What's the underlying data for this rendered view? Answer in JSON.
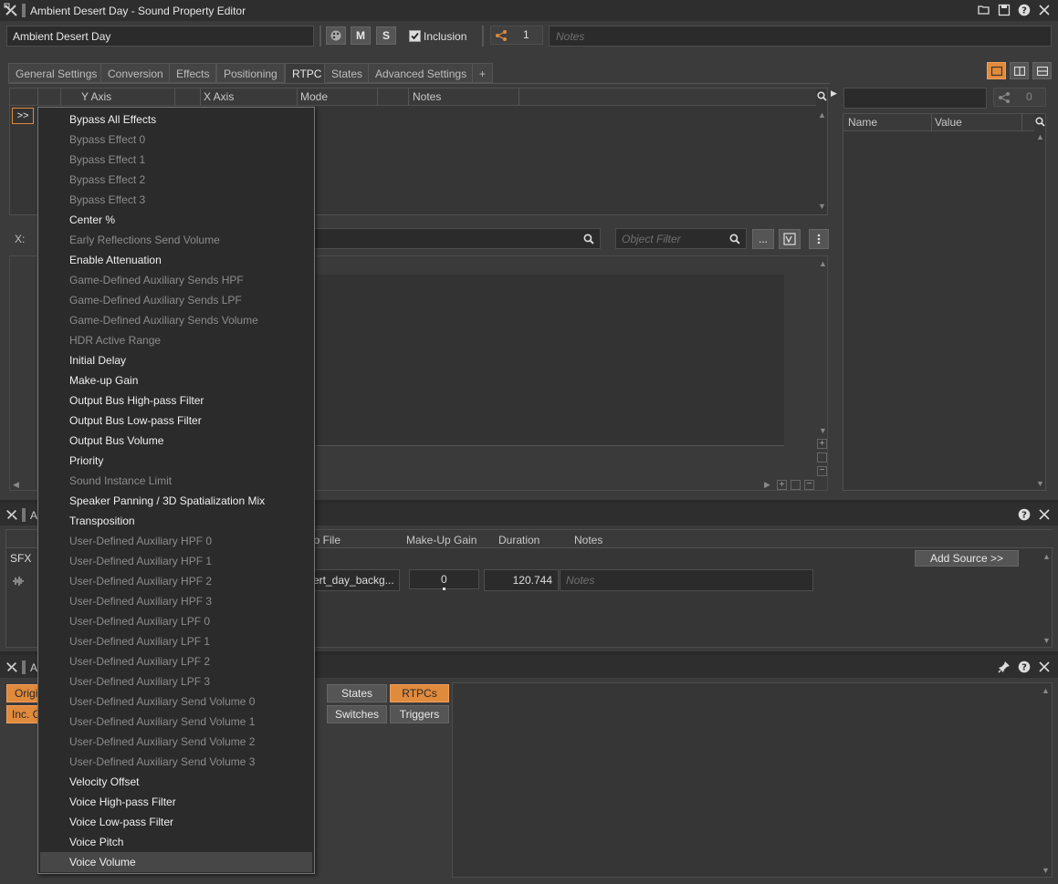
{
  "window": {
    "title": "Ambient Desert Day - Sound Property Editor"
  },
  "object_name": "Ambient Desert Day",
  "toolbar": {
    "m_label": "M",
    "s_label": "S",
    "inclusion_label": "Inclusion",
    "share_count": "1",
    "notes_placeholder": "Notes"
  },
  "tabs": [
    "General Settings",
    "Conversion",
    "Effects",
    "Positioning",
    "RTPC",
    "States",
    "Advanced Settings",
    "+"
  ],
  "rtpc_table": {
    "headers": [
      "Y Axis",
      "X Axis",
      "Mode",
      "Notes"
    ],
    "expand_button": ">>"
  },
  "graph": {
    "x_label": "X:",
    "object_filter_placeholder": "Object Filter",
    "more_button": "..."
  },
  "right_panel": {
    "share_count": "0",
    "headers": [
      "Name",
      "Value"
    ]
  },
  "source_panel": {
    "title_partial": "A",
    "headers": [
      "io File",
      "Make-Up Gain",
      "Duration",
      "Notes"
    ],
    "sfx_label": "SFX",
    "add_source": "Add Source >>",
    "row": {
      "file": "ert_day_backg...",
      "makeup_gain": "0",
      "duration": "120.744",
      "notes_placeholder": "Notes"
    }
  },
  "bottom_panel": {
    "title_partial": "A",
    "orig_label": "Origi",
    "inc_label": "Inc. C",
    "states": "States",
    "rtpcs": "RTPCs",
    "switches": "Switches",
    "triggers": "Triggers"
  },
  "context_menu": {
    "items": [
      {
        "label": "Bypass All Effects",
        "enabled": true
      },
      {
        "label": "Bypass Effect 0",
        "enabled": false
      },
      {
        "label": "Bypass Effect 1",
        "enabled": false
      },
      {
        "label": "Bypass Effect 2",
        "enabled": false
      },
      {
        "label": "Bypass Effect 3",
        "enabled": false
      },
      {
        "label": "Center %",
        "enabled": true
      },
      {
        "label": "Early Reflections Send Volume",
        "enabled": false
      },
      {
        "label": "Enable Attenuation",
        "enabled": true
      },
      {
        "label": "Game-Defined Auxiliary Sends HPF",
        "enabled": false
      },
      {
        "label": "Game-Defined Auxiliary Sends LPF",
        "enabled": false
      },
      {
        "label": "Game-Defined Auxiliary Sends Volume",
        "enabled": false
      },
      {
        "label": "HDR Active Range",
        "enabled": false
      },
      {
        "label": "Initial Delay",
        "enabled": true
      },
      {
        "label": "Make-up Gain",
        "enabled": true
      },
      {
        "label": "Output Bus High-pass Filter",
        "enabled": true
      },
      {
        "label": "Output Bus Low-pass Filter",
        "enabled": true
      },
      {
        "label": "Output Bus Volume",
        "enabled": true
      },
      {
        "label": "Priority",
        "enabled": true
      },
      {
        "label": "Sound Instance Limit",
        "enabled": false
      },
      {
        "label": "Speaker Panning / 3D Spatialization Mix",
        "enabled": true
      },
      {
        "label": "Transposition",
        "enabled": true
      },
      {
        "label": "User-Defined Auxiliary HPF 0",
        "enabled": false
      },
      {
        "label": "User-Defined Auxiliary HPF 1",
        "enabled": false
      },
      {
        "label": "User-Defined Auxiliary HPF 2",
        "enabled": false
      },
      {
        "label": "User-Defined Auxiliary HPF 3",
        "enabled": false
      },
      {
        "label": "User-Defined Auxiliary LPF 0",
        "enabled": false
      },
      {
        "label": "User-Defined Auxiliary LPF 1",
        "enabled": false
      },
      {
        "label": "User-Defined Auxiliary LPF 2",
        "enabled": false
      },
      {
        "label": "User-Defined Auxiliary LPF 3",
        "enabled": false
      },
      {
        "label": "User-Defined Auxiliary Send Volume 0",
        "enabled": false
      },
      {
        "label": "User-Defined Auxiliary Send Volume 1",
        "enabled": false
      },
      {
        "label": "User-Defined Auxiliary Send Volume 2",
        "enabled": false
      },
      {
        "label": "User-Defined Auxiliary Send Volume 3",
        "enabled": false
      },
      {
        "label": "Velocity Offset",
        "enabled": true
      },
      {
        "label": "Voice High-pass Filter",
        "enabled": true
      },
      {
        "label": "Voice Low-pass Filter",
        "enabled": true
      },
      {
        "label": "Voice Pitch",
        "enabled": true
      },
      {
        "label": "Voice Volume",
        "enabled": true,
        "highlighted": true
      }
    ]
  },
  "colors": {
    "accent": "#e08a3c",
    "background": "#3b3b3b",
    "menu_bg": "#2b2b2b"
  }
}
